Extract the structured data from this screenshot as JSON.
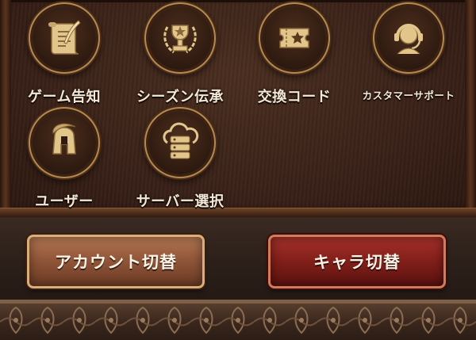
{
  "menu": {
    "items": [
      {
        "label": "ゲーム告知",
        "icon": "scroll-quill-icon"
      },
      {
        "label": "シーズン伝承",
        "icon": "trophy-laurel-icon"
      },
      {
        "label": "交換コード",
        "icon": "ticket-star-icon"
      },
      {
        "label": "カスタマーサポート",
        "icon": "headset-agent-icon"
      },
      {
        "label": "ユーザー",
        "icon": "spartan-helmet-icon"
      },
      {
        "label": "サーバー選択",
        "icon": "cloud-server-icon"
      }
    ]
  },
  "buttons": {
    "account_switch": "アカウント切替",
    "character_switch": "キャラ切替"
  },
  "colors": {
    "icon_gold": "#e2c58a",
    "account_button": "#92573a",
    "character_button": "#85201b",
    "label_text": "#f3e8d6"
  }
}
